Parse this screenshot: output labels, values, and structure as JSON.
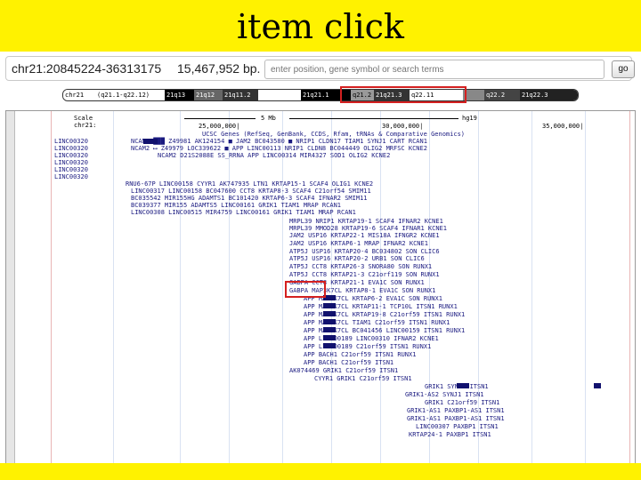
{
  "slide": {
    "title": "item click"
  },
  "colors": {
    "background": "#fff200",
    "highlight": "#d42020",
    "gene_text": "#1a1a80",
    "grid": "#d9e2f2"
  },
  "position_bar": {
    "position": "chr21:20845224-36313175",
    "size": "15,467,952 bp.",
    "search_placeholder": "enter position, gene symbol or search terms",
    "go_label": "go"
  },
  "ideogram": {
    "bands": [
      "chr21",
      "(q21.1-q22.12)",
      "21q13",
      "21q12",
      "21q11.2",
      "21q21.1",
      "q21.2",
      "21q21.3",
      "q22.11",
      "q22.2",
      "21q22.3"
    ]
  },
  "browser": {
    "scale_label": "Scale",
    "chr_label": "chr21:",
    "scale_value": "5 Mb",
    "assembly": "hg19",
    "coords": [
      "25,000,000|",
      "30,000,000|",
      "35,000,000|"
    ],
    "track_title": "UCSC Genes (RefSeq, GenBank, CCDS, Rfam, tRNAs & Comparative Genomics)",
    "left_labels": [
      "LINC00320",
      "LINC00320",
      "LINC00320",
      "LINC00320",
      "LINC00320",
      "LINC00320"
    ],
    "rows": [
      "NCAM2 ███  Z49981  AK124154 ■  JAM2  BC043580 ■  NRIP1  CLDN17  TIAM1  SYNJ1  CART  RCAN1",
      "NCAM2 ⟷   Z49979  LOC339622 ■  APP  LINC00113  NRIP1  CLDN8  BC044449  OLIG2  MRFSC  KCNE2",
      "NCAM2     D21S2088E  SS_RRNA  APP  LINC00314  MIR4327  SOD1  OLIG2  KCNE2",
      "RNU6-67P  LINC00158  CYYR1  AK747935  LTN1  KRTAP15-1  SCAF4  OLIG1  KCNE2",
      "LINC00317  LINC00158  BC047600  CCT8  KRTAP8-3  SCAF4  C21orf54  SMIM11",
      "BC035542  MIR155HG  ADAMTS1  BC101420  KRTAP6-3  SCAF4  IFNAR2  SMIM11",
      "BC039377  MIR155  ADAMTS5  LINC00161  GRIK1  TIAM1  MRAP  RCAN1",
      "LINC00308  LINC00515  MIR4759  LINC00161  GRIK1  TIAM1  MRAP  RCAN1"
    ],
    "mid_rows": [
      "MRPL39  NRIP1  KRTAP19-1  SCAF4  IFNAR2  KCNE1",
      "MRPL39  MMOD28  KRTAP19-6  SCAF4  IFNAR1  KCNE1",
      "JAM2  USP16  KRTAP22-1  MIS18A  IFNGR2  KCNE1",
      "JAM2  USP16  KRTAP6-1  MRAP  IFNAR2  KCNE1",
      "ATP5J  USP16  KRTAP20-4  BC034802  SON  CLIC6",
      "ATP5J  USP16  KRTAP20-2  URB1  SON  CLIC6",
      "ATP5J  CCT8  KRTAP26-3  SNORA80  SON  RUNX1",
      "ATP5J  CCT8  KRTAP21-3  C21orf119  SON  RUNX1",
      "GABPA  CCT8  KRTAP21-1  EVA1C  SON  RUNX1",
      "GABPA  MAP3K7CL  KRTAP8-1  EVA1C  SON  RUNX1",
      "APP  MAP3K7CL  KRTAP6-2  EVA1C  SON  RUNX1",
      "APP  MAP3K7CL  KRTAP11-1  TCP10L  ITSN1  RUNX1",
      "APP  MAP3K7CL  KRTAP19-8  C21orf59  ITSN1  RUNX1",
      "APP  MAP3K7CL  TIAM1  C21orf59  ITSN1  RUNX1",
      "APP  MAP3K7CL  BC041456  LINC00159  ITSN1  RUNX1",
      "APP  LINC00189  LINC00310  IFNAR2  KCNE1",
      "APP  LINC00189  C21orf59  ITSN1  RUNX1",
      "APP  BACH1  C21orf59  ITSN1  RUNX1",
      "APP  BACH1  C21orf59  ITSN1",
      "AK074469  GRIK1  C21orf59  ITSN1",
      "CYYR1  GRIK1  C21orf59  ITSN1",
      "GRIK1  SYNJ1  ITSN1",
      "GRIK1-AS2  SYNJ1  ITSN1",
      "GRIK1  C21orf59  ITSN1",
      "GRIK1-AS1  PAXBP1-AS1  ITSN1",
      "GRIK1-AS1  PAXBP1-AS1  ITSN1",
      "LINC00307  PAXBP1  ITSN1",
      "KRTAP24-1  PAXBP1  ITSN1"
    ]
  }
}
